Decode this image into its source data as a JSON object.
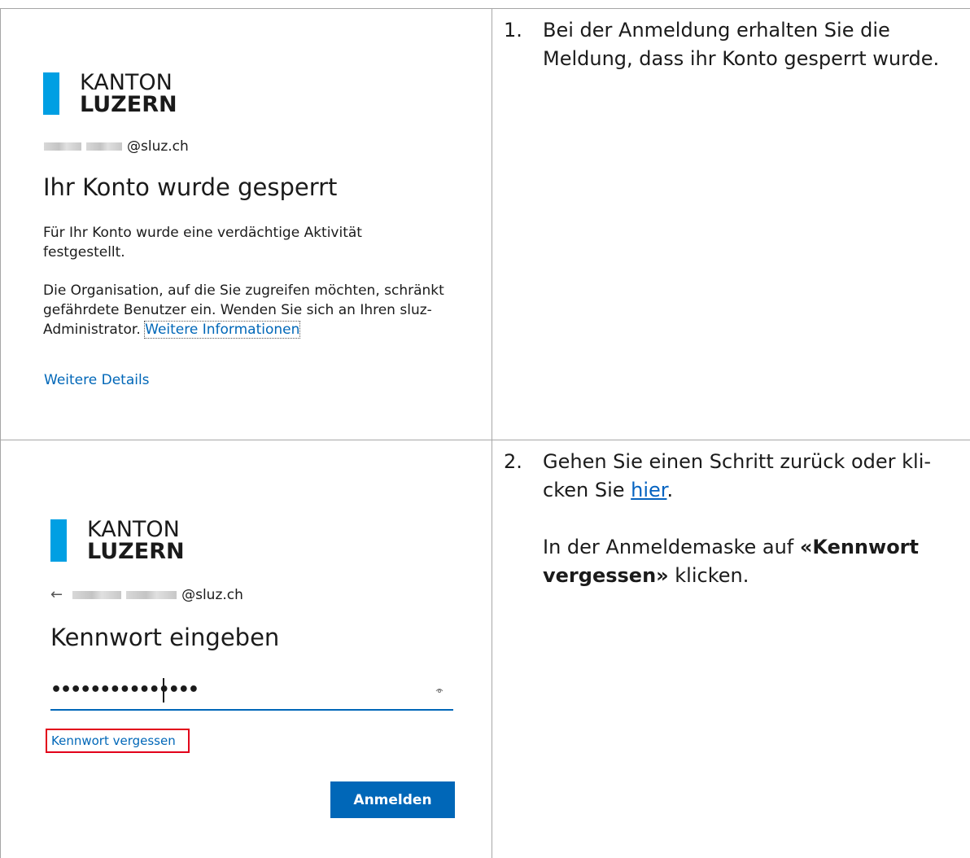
{
  "logo": {
    "line1": "KANTON",
    "line2": "LUZERN",
    "brand_color": "#009fe3"
  },
  "panel1": {
    "email_domain": "@sluz.ch",
    "heading": "Ihr Konto wurde gesperrt",
    "para1": "Für Ihr Konto wurde eine verdächtige Aktivität festgestellt.",
    "para2_text": "Die Organisation, auf die Sie zugreifen möchten, schränkt gefährdete Benutzer ein. Wenden Sie sich an Ihren sluz-Administrator.",
    "para2_link": "Weitere Informationen",
    "details_link": "Weitere Details"
  },
  "panel2": {
    "back_icon": "back-arrow-icon",
    "email_domain": "@sluz.ch",
    "heading": "Kennwort eingeben",
    "password_masked": "•••••••••••••••",
    "forgot_link": "Kennwort vergessen",
    "signin_button": "Anmelden",
    "accent_color": "#0067b8",
    "highlight_color": "#e2001a"
  },
  "steps": [
    {
      "number": "1.",
      "text": "Bei der Anmeldung erhalten Sie die Meldung, dass ihr Konto gesperrt wurde."
    },
    {
      "number": "2.",
      "line1_a": "Gehen Sie einen Schritt zurück oder kli-",
      "line2_a": "cken Sie ",
      "link": "hier",
      "line2_b": ".",
      "para2_a": "In der Anmeldemaske auf ",
      "para2_bold": "«Kennwort vergessen»",
      "para2_b": " klicken."
    }
  ]
}
